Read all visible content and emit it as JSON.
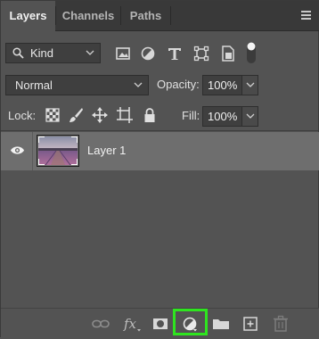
{
  "tabs": [
    {
      "label": "Layers",
      "active": true
    },
    {
      "label": "Channels",
      "active": false
    },
    {
      "label": "Paths",
      "active": false
    }
  ],
  "filter": {
    "kind_label": "Kind",
    "icons": [
      "image-filter-icon",
      "adjustment-filter-icon",
      "type-filter-icon",
      "shape-filter-icon",
      "smart-object-filter-icon",
      "filter-toggle-icon"
    ]
  },
  "blend": {
    "mode": "Normal",
    "opacity_label": "Opacity:",
    "opacity_value": "100%"
  },
  "lock": {
    "label": "Lock:",
    "icons": [
      "lock-transparent-pixels-icon",
      "lock-image-pixels-icon",
      "lock-position-icon",
      "lock-artboard-icon",
      "lock-all-icon"
    ],
    "fill_label": "Fill:",
    "fill_value": "100%"
  },
  "layers": [
    {
      "name": "Layer 1",
      "visible": true,
      "selected": true
    }
  ],
  "bottom_icons": [
    "link-layers-icon",
    "fx-layer-style-icon",
    "add-mask-icon",
    "adjustment-layer-icon",
    "new-group-icon",
    "new-layer-icon",
    "delete-layer-icon"
  ],
  "colors": {
    "panel_bg": "#535353",
    "selected_row": "#6e6e6e",
    "highlight": "#2ee51f"
  }
}
